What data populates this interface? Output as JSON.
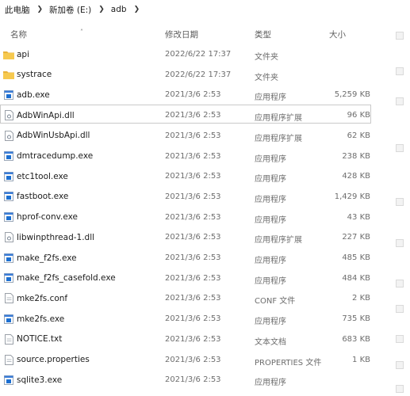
{
  "breadcrumb": [
    "此电脑",
    "新加卷 (E:)",
    "adb"
  ],
  "columns": {
    "name": "名称",
    "date": "修改日期",
    "type": "类型",
    "size": "大小"
  },
  "files": [
    {
      "name": "api",
      "date": "2022/6/22 17:37",
      "type": "文件夹",
      "size": "",
      "icon": "folder-icon"
    },
    {
      "name": "systrace",
      "date": "2022/6/22 17:37",
      "type": "文件夹",
      "size": "",
      "icon": "folder-icon"
    },
    {
      "name": "adb.exe",
      "date": "2021/3/6 2:53",
      "type": "应用程序",
      "size": "5,259 KB",
      "icon": "exe-icon"
    },
    {
      "name": "AdbWinApi.dll",
      "date": "2021/3/6 2:53",
      "type": "应用程序扩展",
      "size": "96 KB",
      "icon": "dll-icon"
    },
    {
      "name": "AdbWinUsbApi.dll",
      "date": "2021/3/6 2:53",
      "type": "应用程序扩展",
      "size": "62 KB",
      "icon": "dll-icon"
    },
    {
      "name": "dmtracedump.exe",
      "date": "2021/3/6 2:53",
      "type": "应用程序",
      "size": "238 KB",
      "icon": "exe-icon"
    },
    {
      "name": "etc1tool.exe",
      "date": "2021/3/6 2:53",
      "type": "应用程序",
      "size": "428 KB",
      "icon": "exe-icon"
    },
    {
      "name": "fastboot.exe",
      "date": "2021/3/6 2:53",
      "type": "应用程序",
      "size": "1,429 KB",
      "icon": "exe-icon"
    },
    {
      "name": "hprof-conv.exe",
      "date": "2021/3/6 2:53",
      "type": "应用程序",
      "size": "43 KB",
      "icon": "exe-icon"
    },
    {
      "name": "libwinpthread-1.dll",
      "date": "2021/3/6 2:53",
      "type": "应用程序扩展",
      "size": "227 KB",
      "icon": "dll-icon"
    },
    {
      "name": "make_f2fs.exe",
      "date": "2021/3/6 2:53",
      "type": "应用程序",
      "size": "485 KB",
      "icon": "exe-icon"
    },
    {
      "name": "make_f2fs_casefold.exe",
      "date": "2021/3/6 2:53",
      "type": "应用程序",
      "size": "484 KB",
      "icon": "exe-icon"
    },
    {
      "name": "mke2fs.conf",
      "date": "2021/3/6 2:53",
      "type": "CONF 文件",
      "size": "2 KB",
      "icon": "file-icon"
    },
    {
      "name": "mke2fs.exe",
      "date": "2021/3/6 2:53",
      "type": "应用程序",
      "size": "735 KB",
      "icon": "exe-icon"
    },
    {
      "name": "NOTICE.txt",
      "date": "2021/3/6 2:53",
      "type": "文本文档",
      "size": "683 KB",
      "icon": "file-icon"
    },
    {
      "name": "source.properties",
      "date": "2021/3/6 2:53",
      "type": "PROPERTIES 文件",
      "size": "1 KB",
      "icon": "file-icon"
    },
    {
      "name": "sqlite3.exe",
      "date": "2021/3/6 2:53",
      "type": "应用程序",
      "size": "",
      "icon": "exe-icon"
    }
  ],
  "colors": {
    "folder": "#f2c14e",
    "exe_blue": "#1c6fd1",
    "selected_border": "#c9c9c9"
  }
}
